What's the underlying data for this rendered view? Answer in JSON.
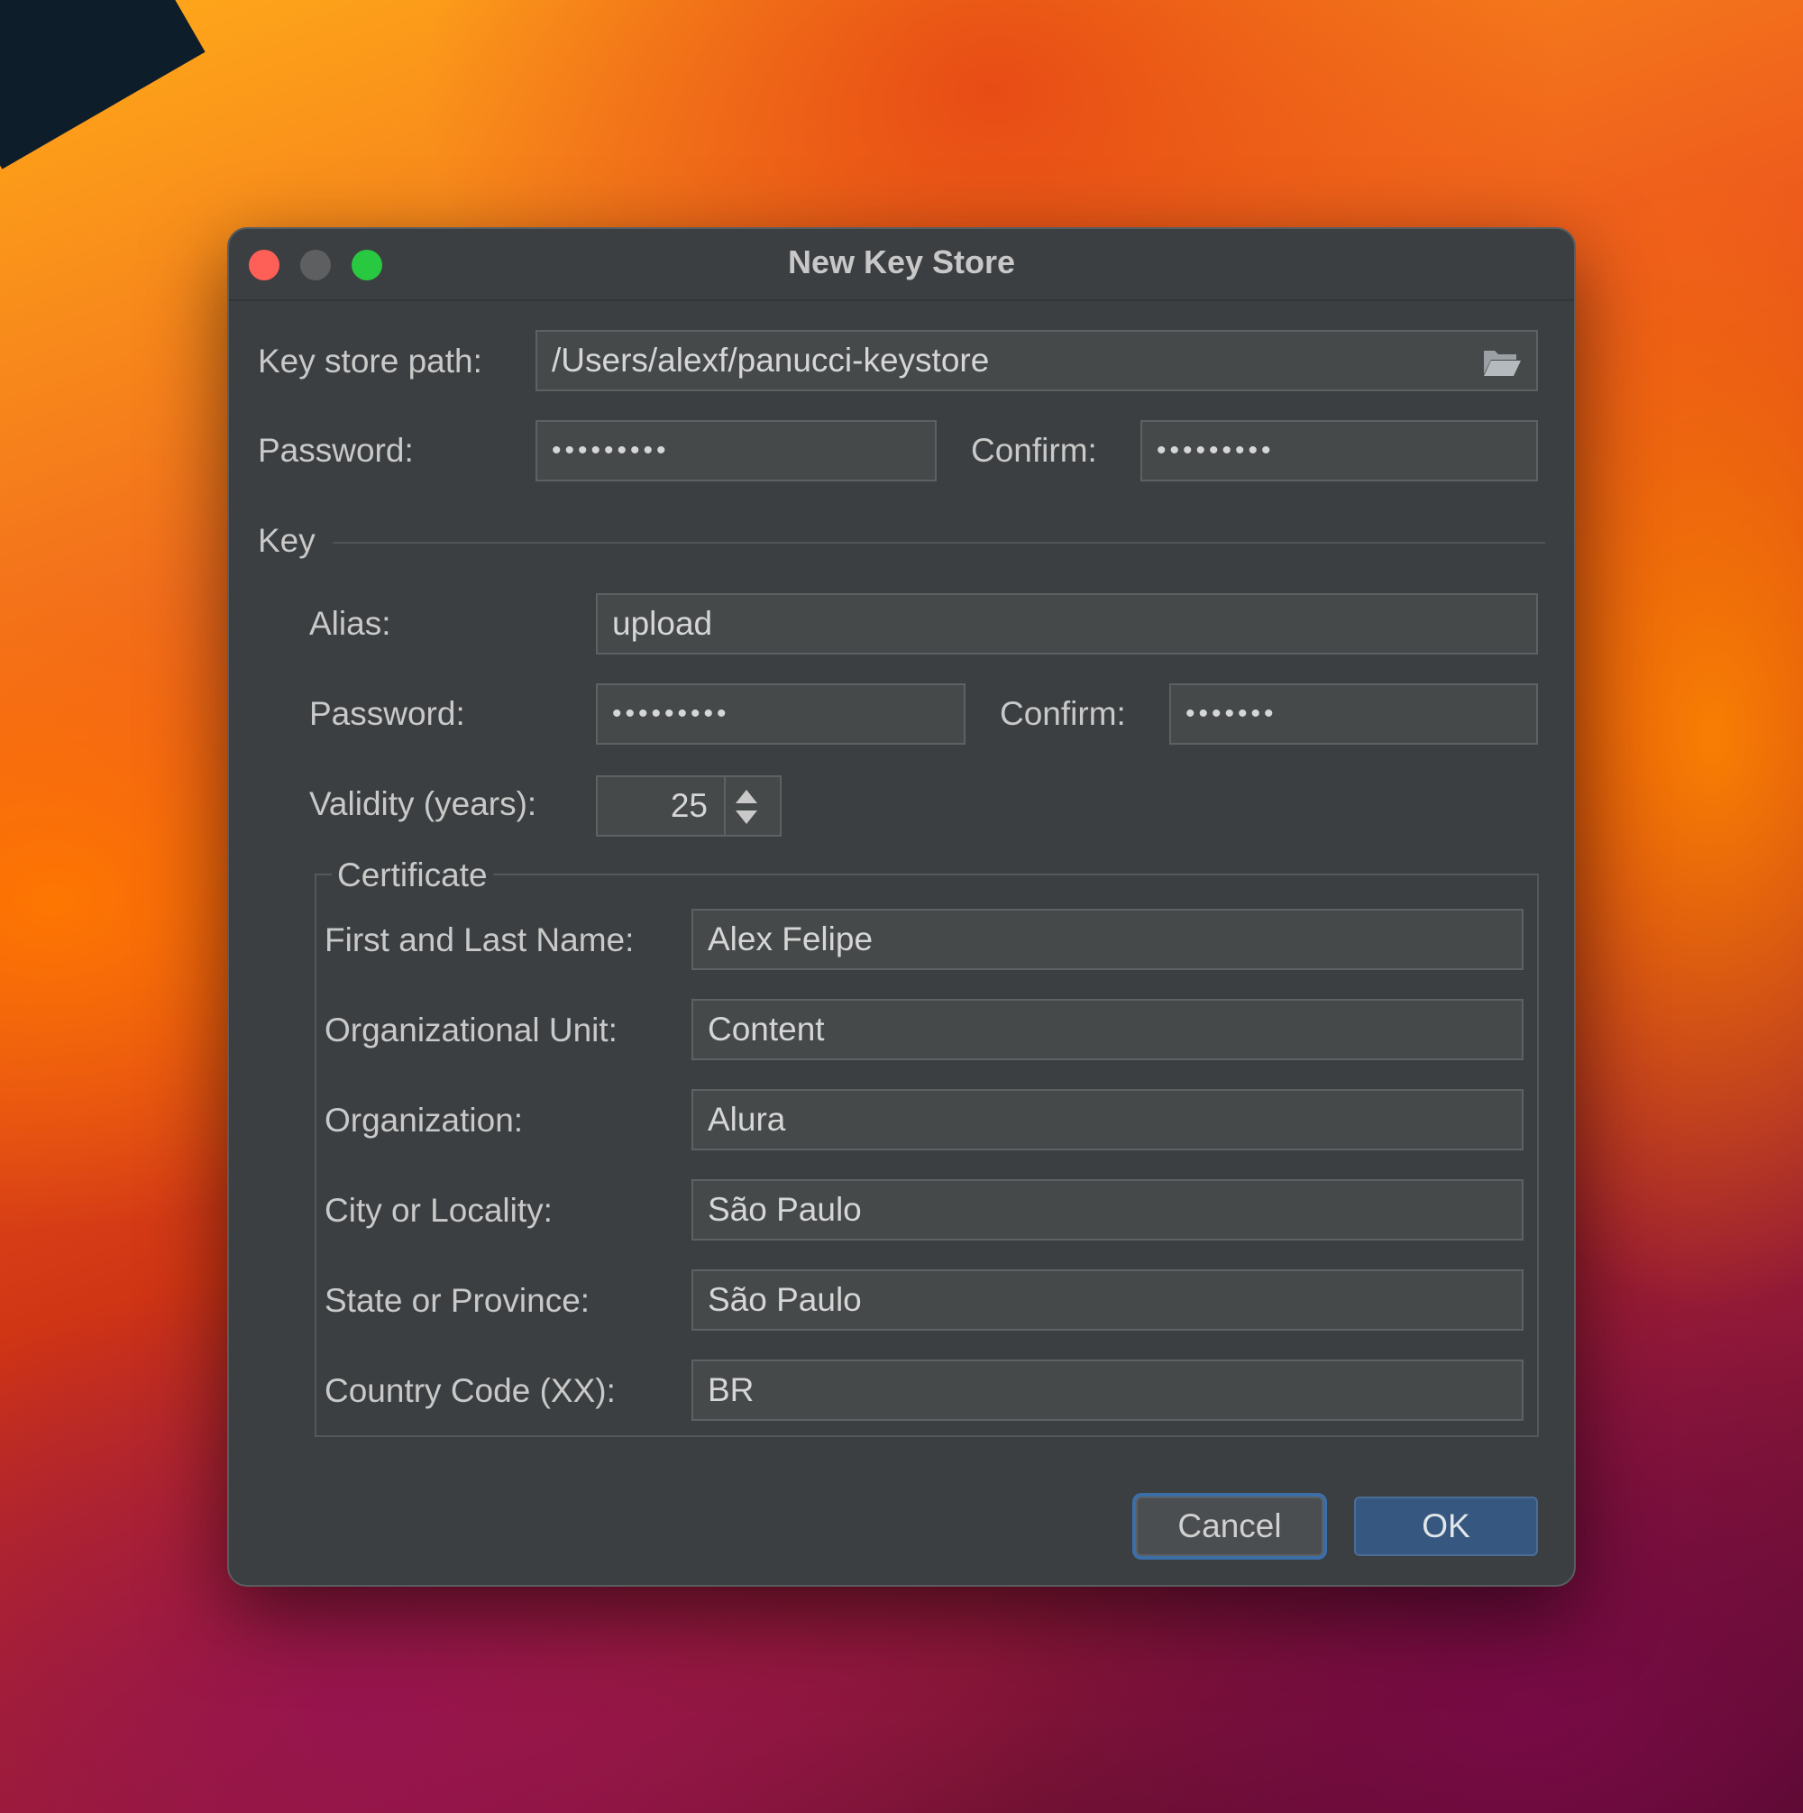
{
  "window": {
    "title": "New Key Store"
  },
  "keystore": {
    "path_label": "Key store path:",
    "path_value": "/Users/alexf/panucci-keystore",
    "password_label": "Password:",
    "password_value": "•••••••••",
    "confirm_label": "Confirm:",
    "confirm_value": "•••••••••"
  },
  "key": {
    "section_label": "Key",
    "alias_label": "Alias:",
    "alias_value": "upload",
    "password_label": "Password:",
    "password_value": "•••••••••",
    "confirm_label": "Confirm:",
    "confirm_value": "•••••••",
    "validity_label": "Validity (years):",
    "validity_value": "25"
  },
  "certificate": {
    "group_label": "Certificate",
    "fields": [
      {
        "label": "First and Last Name:",
        "value": "Alex Felipe"
      },
      {
        "label": "Organizational Unit:",
        "value": "Content"
      },
      {
        "label": "Organization:",
        "value": "Alura"
      },
      {
        "label": "City or Locality:",
        "value": "São Paulo"
      },
      {
        "label": "State or Province:",
        "value": "São Paulo"
      },
      {
        "label": "Country Code (XX):",
        "value": "BR"
      }
    ]
  },
  "buttons": {
    "cancel": "Cancel",
    "ok": "OK"
  },
  "icons": {
    "folder": "folder-open-icon",
    "spinner": "spinner-arrows-icon"
  },
  "colors": {
    "dialog_bg": "#3c3f41",
    "field_bg": "#45494a",
    "ok_button": "#365880",
    "focus_ring": "#3c6ea8"
  }
}
